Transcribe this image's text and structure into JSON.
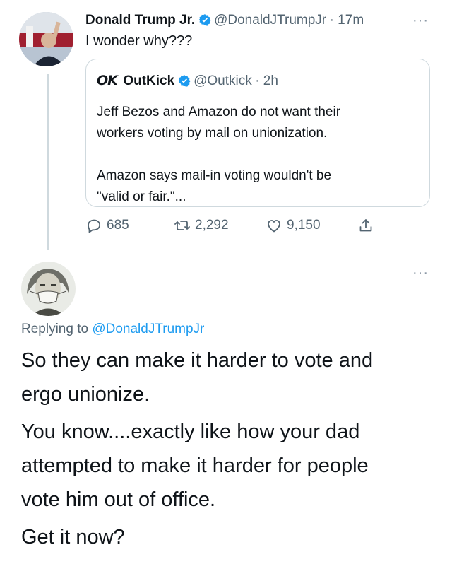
{
  "tweet": {
    "author_name": "Donald Trump Jr.",
    "author_handle": "@DonaldJTrumpJr",
    "time": "· 17m",
    "more": "···",
    "text": "I wonder why???"
  },
  "quoted": {
    "logo": "OK",
    "author_name": "OutKick",
    "author_handle": "@Outkick",
    "time": "· 2h",
    "para1_line1": "Jeff Bezos and Amazon do not want their",
    "para1_line2": "workers voting by mail on unionization.",
    "para2_line1": "Amazon says mail-in voting wouldn't be",
    "para2_line2": "\"valid or fair.\"..."
  },
  "actions": {
    "replies": "685",
    "retweets": "2,292",
    "likes": "9,150"
  },
  "reply": {
    "more": "···",
    "replying_prefix": "Replying to",
    "replying_handle": "@DonaldJTrumpJr",
    "p1_l1": "So they can make it harder to vote and",
    "p1_l2": "ergo unionize.",
    "p2_l1": "You know....exactly like how your dad",
    "p2_l2": "attempted to make it harder for people",
    "p2_l3": "vote him out of office.",
    "p3_l1": "Get it now?"
  },
  "icons": {
    "verified": "verified-badge-icon",
    "reply": "reply-bubble-icon",
    "retweet": "retweet-arrows-icon",
    "like": "heart-icon",
    "share": "share-upload-icon"
  },
  "colors": {
    "text": "#0f1419",
    "secondary": "#536471",
    "accent": "#1d9bf0",
    "border": "#cfd9de"
  }
}
